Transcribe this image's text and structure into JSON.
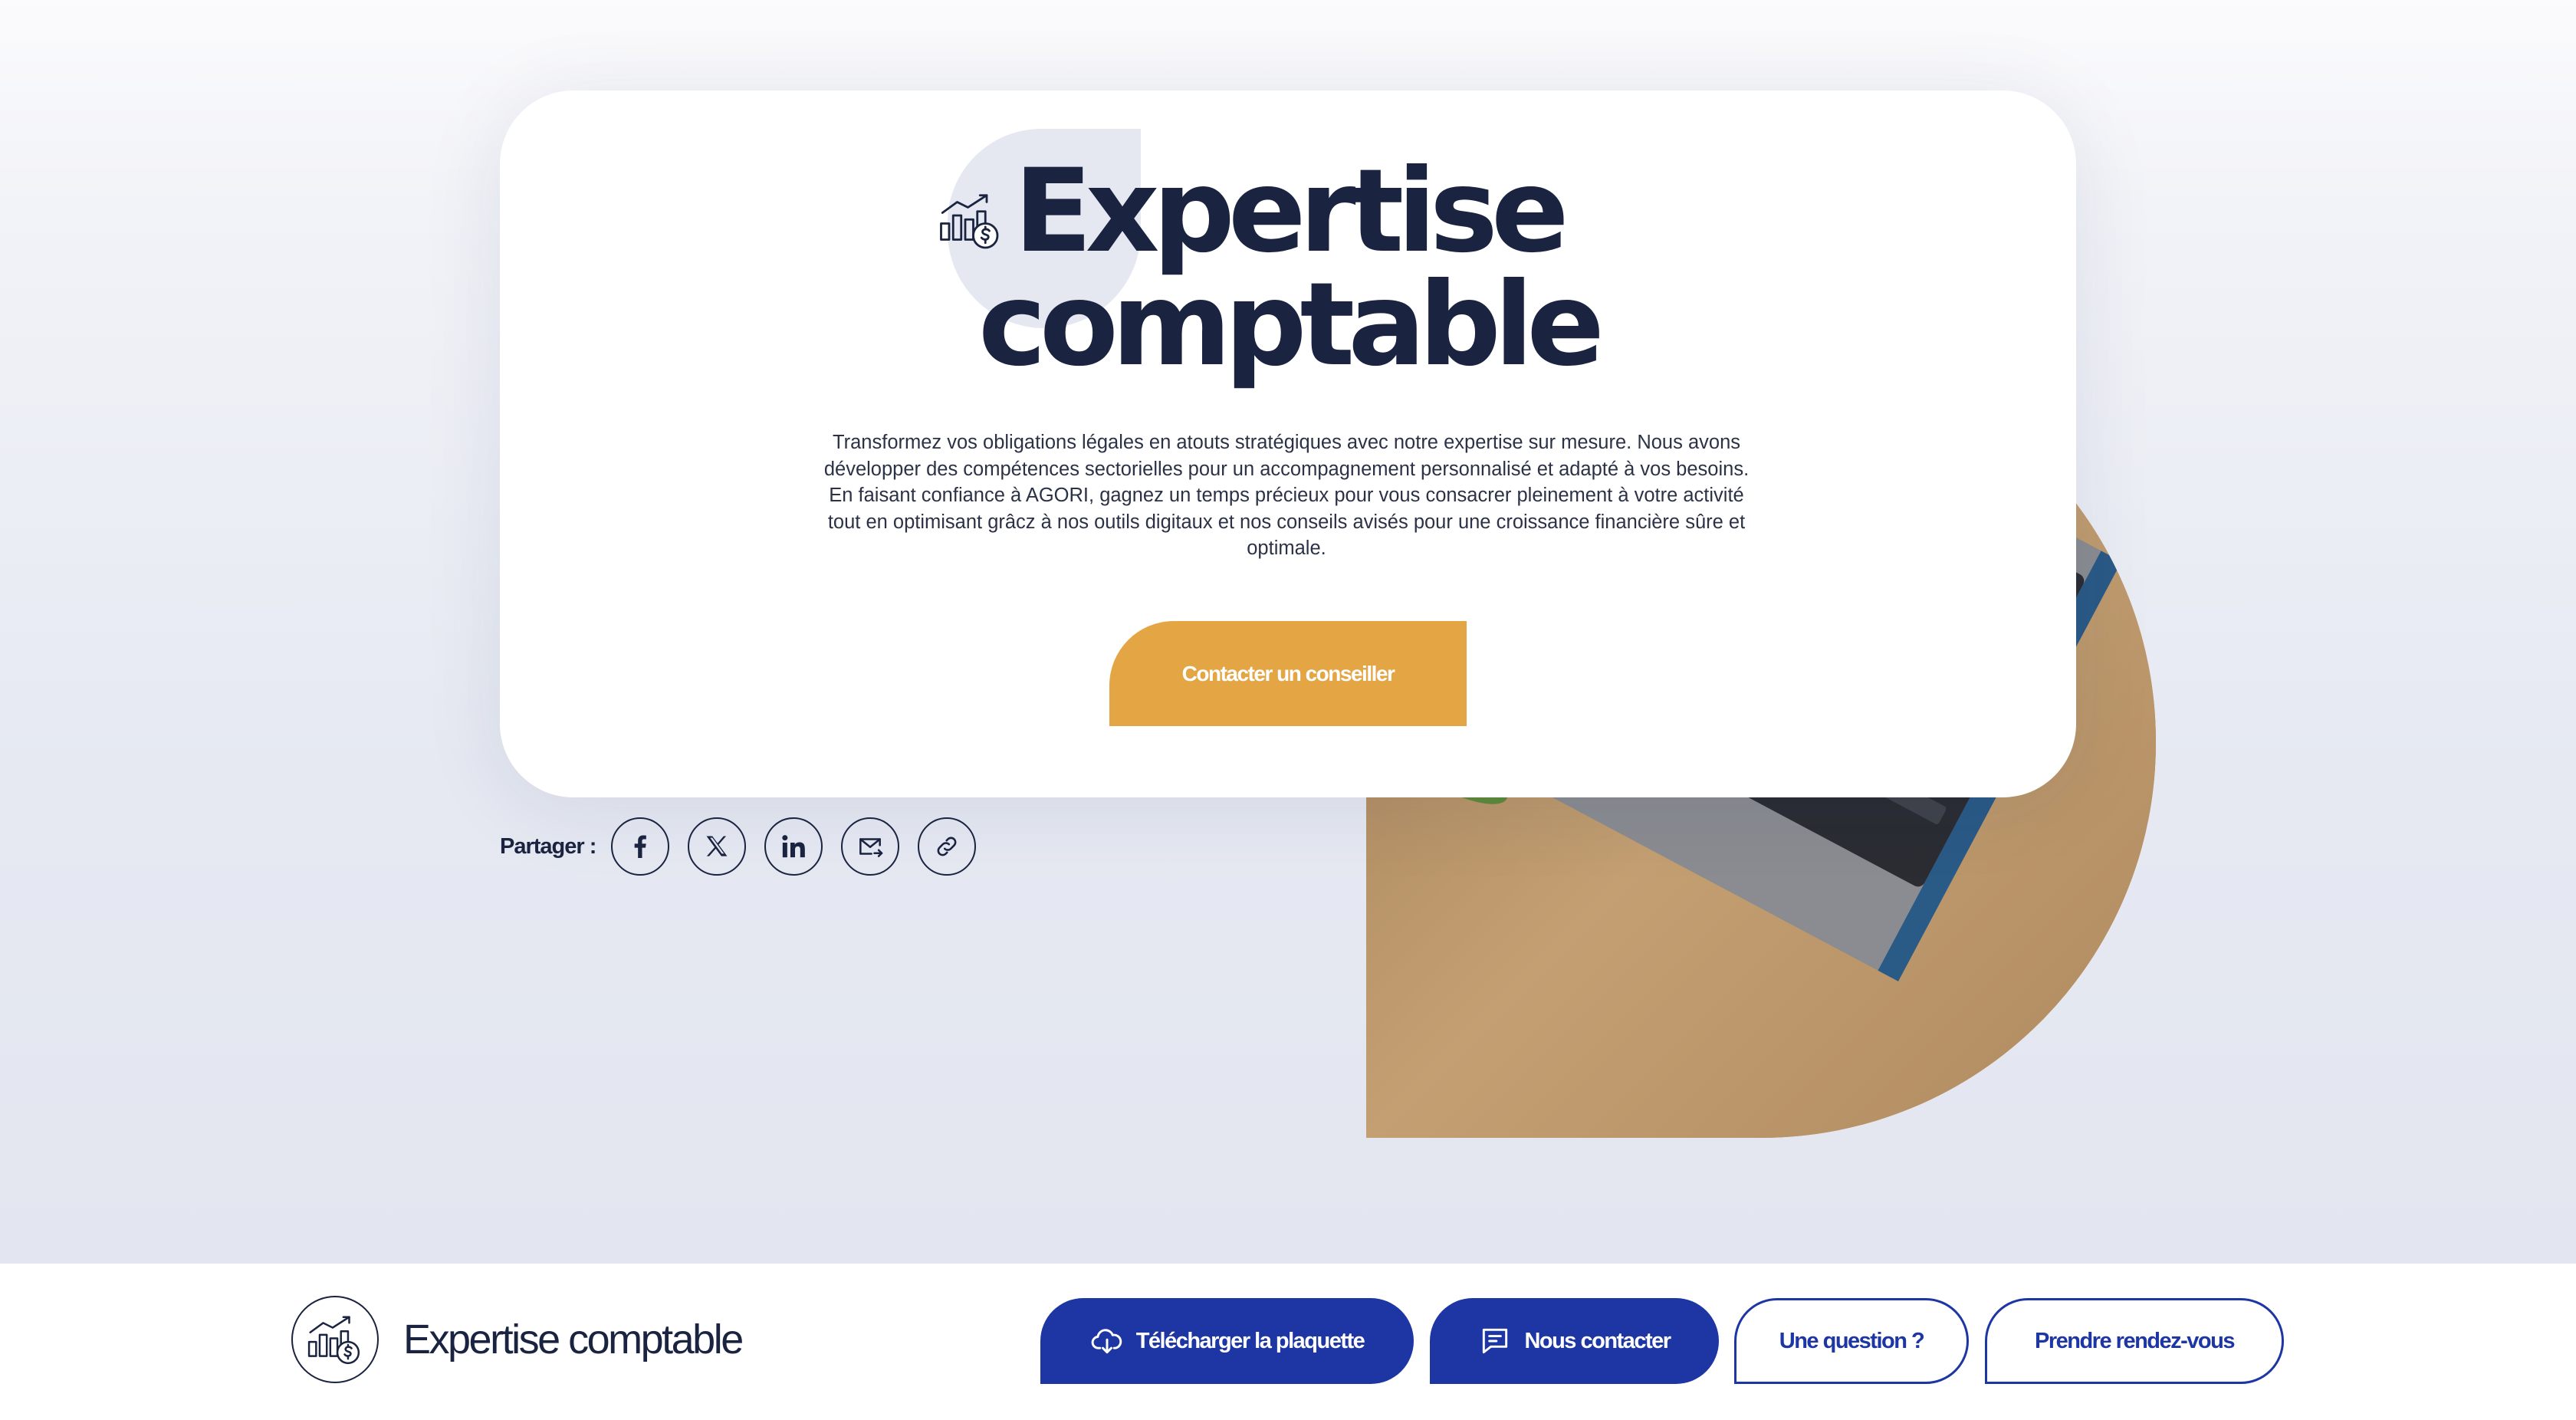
{
  "hero": {
    "title_line1": "Expertise",
    "title_line2": "comptable",
    "description": "Transformez vos obligations légales en atouts stratégiques avec notre expertise sur mesure. Nous avons développer des compétences sectorielles pour un accompagnement personnalisé et adapté à vos besoins. En faisant confiance à AGORI, gagnez un temps précieux pour vous consacrer pleinement à votre activité tout en optimisant grâcz à nos outils digitaux et nos conseils avisés pour une croissance financière sûre et optimale.",
    "cta_label": "Contacter un conseiller",
    "icon": "chart-dollar-icon"
  },
  "share": {
    "label": "Partager :",
    "buttons": [
      {
        "icon": "facebook-icon"
      },
      {
        "icon": "x-twitter-icon"
      },
      {
        "icon": "linkedin-icon"
      },
      {
        "icon": "email-icon"
      },
      {
        "icon": "link-icon"
      }
    ]
  },
  "bottom_bar": {
    "icon": "chart-dollar-icon",
    "title": "Expertise comptable",
    "buttons": [
      {
        "label": "Télécharger la plaquette",
        "icon": "cloud-download-icon",
        "style": "filled"
      },
      {
        "label": "Nous contacter",
        "icon": "chat-icon",
        "style": "filled"
      },
      {
        "label": "Une question ?",
        "style": "outline"
      },
      {
        "label": "Prendre rendez-vous",
        "style": "outline"
      }
    ]
  },
  "colors": {
    "navy": "#1a2340",
    "brand_blue": "#1d36a3",
    "accent_orange": "#e4a545",
    "page_background": "#e6e9f2"
  }
}
